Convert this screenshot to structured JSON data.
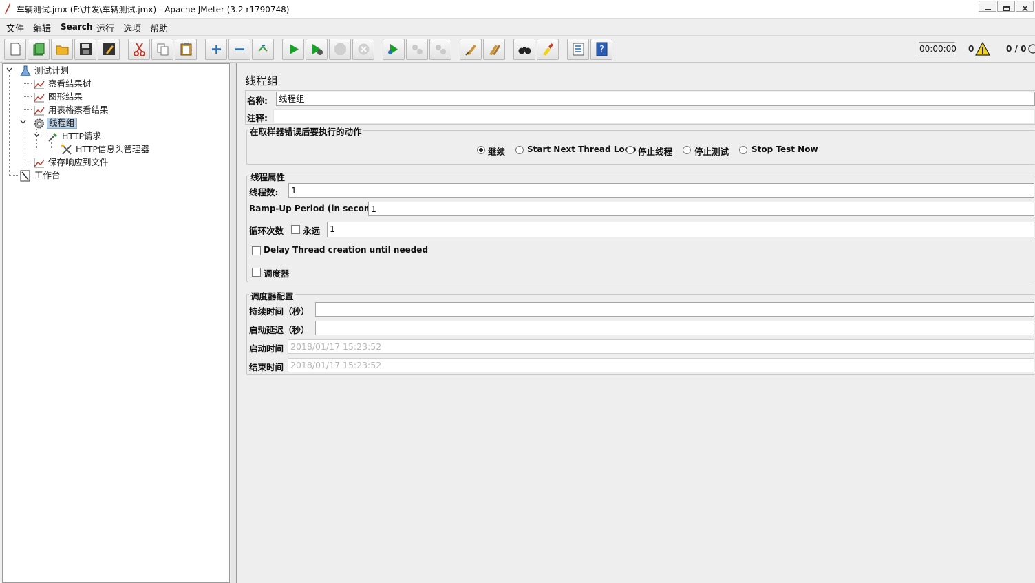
{
  "window": {
    "title": "车辆测试.jmx (F:\\并发\\车辆测试.jmx) - Apache JMeter (3.2 r1790748)"
  },
  "menu": [
    "文件",
    "编辑",
    "Search",
    "运行",
    "选项",
    "帮助"
  ],
  "toolbar": {
    "buttons": [
      "new-icon",
      "templates-icon",
      "open-icon",
      "save-icon",
      "save-as-icon",
      "cut-icon",
      "copy-icon",
      "paste-icon",
      "expand-icon",
      "collapse-icon",
      "toggle-icon",
      "start-icon",
      "start-no-pause-icon",
      "stop-icon",
      "shutdown-icon",
      "remote-start-icon",
      "remote-stop-icon",
      "remote-shutdown-icon",
      "clear-icon",
      "clear-all-icon",
      "search-icon",
      "reset-search-icon",
      "function-helper-icon",
      "help-icon"
    ],
    "timer": "00:00:00",
    "error_count": "0",
    "threads": "0 / 0"
  },
  "tree": {
    "test_plan": "测试计划",
    "view_results_tree": "察看结果树",
    "graph_results": "图形结果",
    "table_results": "用表格察看结果",
    "thread_group": "线程组",
    "http_request": "HTTP请求",
    "header_manager": "HTTP信息头管理器",
    "save_responses": "保存响应到文件",
    "workbench": "工作台"
  },
  "panel": {
    "title": "线程组",
    "name_label": "名称:",
    "name_value": "线程组",
    "comment_label": "注释:",
    "comment_value": "",
    "error_action": {
      "title": "在取样器错误后要执行的动作",
      "options": [
        "继续",
        "Start Next Thread Loop",
        "停止线程",
        "停止测试",
        "Stop Test Now"
      ],
      "selected": "继续"
    },
    "thread_props": {
      "title": "线程属性",
      "threads_label": "线程数:",
      "threads_value": "1",
      "rampup_label": "Ramp-Up Period (in seconds):",
      "rampup_value": "1",
      "loop_label": "循环次数",
      "forever_label": "永远",
      "loop_value": "1",
      "delay_label": "Delay Thread creation until needed",
      "scheduler_label": "调度器"
    },
    "scheduler": {
      "title": "调度器配置",
      "duration_label": "持续时间（秒）",
      "duration_value": "",
      "delay_label": "启动延迟（秒）",
      "delay_value": "",
      "start_label": "启动时间",
      "start_value": "2018/01/17 15:23:52",
      "end_label": "结束时间",
      "end_value": "2018/01/17 15:23:52"
    }
  },
  "colors": {
    "selection": "#b8cfe5",
    "start_green": "#1aa12a",
    "warn_yellow": "#f3d21c"
  }
}
